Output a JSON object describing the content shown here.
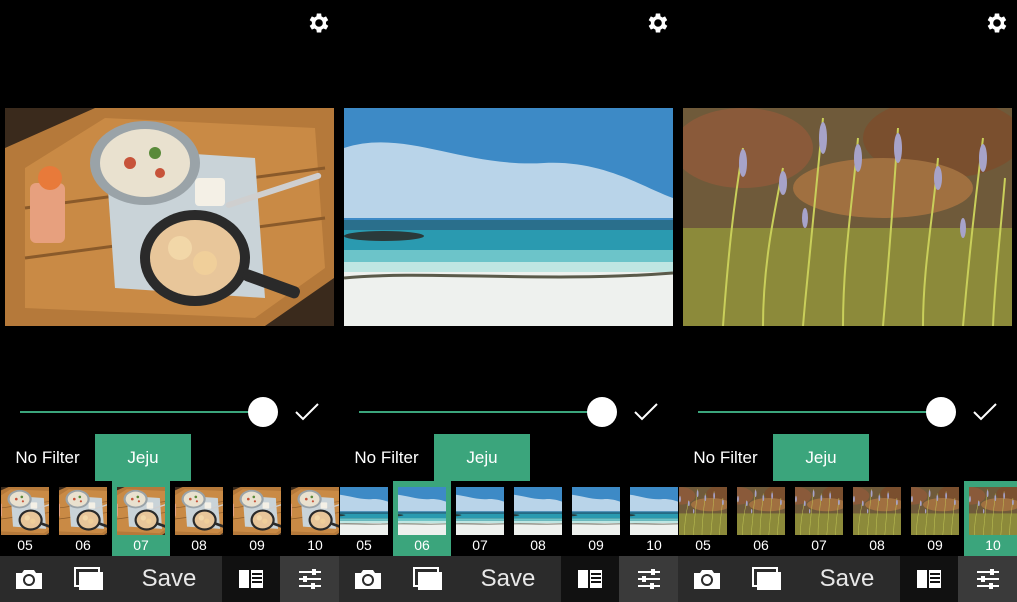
{
  "icons": {
    "settings": "gear-icon",
    "apply": "checkmark-icon",
    "camera": "camera-icon",
    "frames": "frames-icon",
    "film": "film-icon",
    "adjust": "sliders-icon"
  },
  "colors": {
    "accent": "#3ba57c",
    "toolbar": "#2b2b2b",
    "background": "#000000"
  },
  "panels": [
    {
      "scene": "food",
      "slider_value": 1.0,
      "tabs": {
        "no_filter": "No Filter",
        "active": "Jeju"
      },
      "thumbnails": [
        {
          "label": "05",
          "selected": false
        },
        {
          "label": "06",
          "selected": false
        },
        {
          "label": "07",
          "selected": true
        },
        {
          "label": "08",
          "selected": false
        },
        {
          "label": "09",
          "selected": false
        },
        {
          "label": "10",
          "selected": false
        }
      ],
      "toolbar": {
        "save_label": "Save"
      }
    },
    {
      "scene": "beach",
      "slider_value": 1.0,
      "tabs": {
        "no_filter": "No Filter",
        "active": "Jeju"
      },
      "thumbnails": [
        {
          "label": "05",
          "selected": false
        },
        {
          "label": "06",
          "selected": true
        },
        {
          "label": "07",
          "selected": false
        },
        {
          "label": "08",
          "selected": false
        },
        {
          "label": "09",
          "selected": false
        },
        {
          "label": "10",
          "selected": false
        }
      ],
      "toolbar": {
        "save_label": "Save"
      }
    },
    {
      "scene": "flowers",
      "slider_value": 1.0,
      "tabs": {
        "no_filter": "No Filter",
        "active": "Jeju"
      },
      "thumbnails": [
        {
          "label": "05",
          "selected": false
        },
        {
          "label": "06",
          "selected": false
        },
        {
          "label": "07",
          "selected": false
        },
        {
          "label": "08",
          "selected": false
        },
        {
          "label": "09",
          "selected": false
        },
        {
          "label": "10",
          "selected": true
        }
      ],
      "toolbar": {
        "save_label": "Save"
      }
    }
  ]
}
